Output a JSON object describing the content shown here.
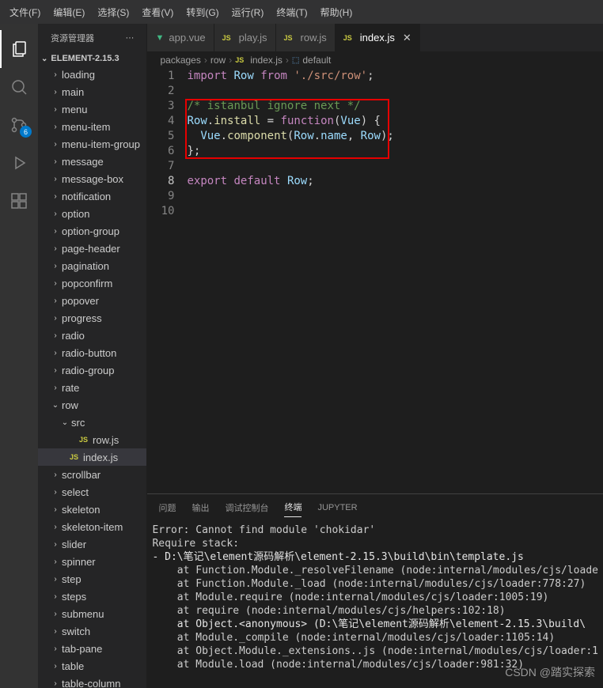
{
  "menubar": {
    "items": [
      "文件(F)",
      "编辑(E)",
      "选择(S)",
      "查看(V)",
      "转到(G)",
      "运行(R)",
      "终端(T)",
      "帮助(H)"
    ]
  },
  "activitybar": {
    "scm_badge": "6"
  },
  "sidebar": {
    "title": "资源管理器",
    "section": "ELEMENT-2.15.3",
    "items": [
      {
        "label": "loading",
        "chev": "›",
        "indent": 0
      },
      {
        "label": "main",
        "chev": "›",
        "indent": 0
      },
      {
        "label": "menu",
        "chev": "›",
        "indent": 0
      },
      {
        "label": "menu-item",
        "chev": "›",
        "indent": 0
      },
      {
        "label": "menu-item-group",
        "chev": "›",
        "indent": 0
      },
      {
        "label": "message",
        "chev": "›",
        "indent": 0
      },
      {
        "label": "message-box",
        "chev": "›",
        "indent": 0
      },
      {
        "label": "notification",
        "chev": "›",
        "indent": 0
      },
      {
        "label": "option",
        "chev": "›",
        "indent": 0
      },
      {
        "label": "option-group",
        "chev": "›",
        "indent": 0
      },
      {
        "label": "page-header",
        "chev": "›",
        "indent": 0
      },
      {
        "label": "pagination",
        "chev": "›",
        "indent": 0
      },
      {
        "label": "popconfirm",
        "chev": "›",
        "indent": 0
      },
      {
        "label": "popover",
        "chev": "›",
        "indent": 0
      },
      {
        "label": "progress",
        "chev": "›",
        "indent": 0
      },
      {
        "label": "radio",
        "chev": "›",
        "indent": 0
      },
      {
        "label": "radio-button",
        "chev": "›",
        "indent": 0
      },
      {
        "label": "radio-group",
        "chev": "›",
        "indent": 0
      },
      {
        "label": "rate",
        "chev": "›",
        "indent": 0
      },
      {
        "label": "row",
        "chev": "⌄",
        "indent": 0
      },
      {
        "label": "src",
        "chev": "⌄",
        "indent": 1
      },
      {
        "label": "row.js",
        "file": "js",
        "indent": 2
      },
      {
        "label": "index.js",
        "file": "js",
        "indent": 1,
        "selected": true
      },
      {
        "label": "scrollbar",
        "chev": "›",
        "indent": 0
      },
      {
        "label": "select",
        "chev": "›",
        "indent": 0
      },
      {
        "label": "skeleton",
        "chev": "›",
        "indent": 0
      },
      {
        "label": "skeleton-item",
        "chev": "›",
        "indent": 0
      },
      {
        "label": "slider",
        "chev": "›",
        "indent": 0
      },
      {
        "label": "spinner",
        "chev": "›",
        "indent": 0
      },
      {
        "label": "step",
        "chev": "›",
        "indent": 0
      },
      {
        "label": "steps",
        "chev": "›",
        "indent": 0
      },
      {
        "label": "submenu",
        "chev": "›",
        "indent": 0
      },
      {
        "label": "switch",
        "chev": "›",
        "indent": 0
      },
      {
        "label": "tab-pane",
        "chev": "›",
        "indent": 0
      },
      {
        "label": "table",
        "chev": "›",
        "indent": 0
      },
      {
        "label": "table-column",
        "chev": "›",
        "indent": 0
      }
    ]
  },
  "tabs": [
    {
      "label": "app.vue",
      "type": "vue"
    },
    {
      "label": "play.js",
      "type": "js"
    },
    {
      "label": "row.js",
      "type": "js"
    },
    {
      "label": "index.js",
      "type": "js",
      "active": true
    }
  ],
  "breadcrumbs": {
    "parts": [
      "packages",
      "row",
      "index.js",
      "default"
    ],
    "js_icon": "JS"
  },
  "code": {
    "line_numbers": [
      "1",
      "2",
      "3",
      "4",
      "5",
      "6",
      "7",
      "8",
      "9",
      "10"
    ],
    "current_line": "8"
  },
  "panel": {
    "tabs": [
      "问题",
      "输出",
      "调试控制台",
      "终端",
      "JUPYTER"
    ],
    "active": "终端"
  },
  "terminal": {
    "lines": [
      "",
      "Error: Cannot find module 'chokidar'",
      "Require stack:",
      "- D:\\笔记\\element源码解析\\element-2.15.3\\build\\bin\\template.js",
      "    at Function.Module._resolveFilename (node:internal/modules/cjs/loade",
      "    at Function.Module._load (node:internal/modules/cjs/loader:778:27)",
      "    at Module.require (node:internal/modules/cjs/loader:1005:19)",
      "    at require (node:internal/modules/cjs/helpers:102:18)",
      "    at Object.<anonymous> (D:\\笔记\\element源码解析\\element-2.15.3\\build\\",
      "    at Module._compile (node:internal/modules/cjs/loader:1105:14)",
      "    at Object.Module._extensions..js (node:internal/modules/cjs/loader:1",
      "    at Module.load (node:internal/modules/cjs/loader:981:32)"
    ]
  },
  "watermark": "CSDN @踏实探索"
}
